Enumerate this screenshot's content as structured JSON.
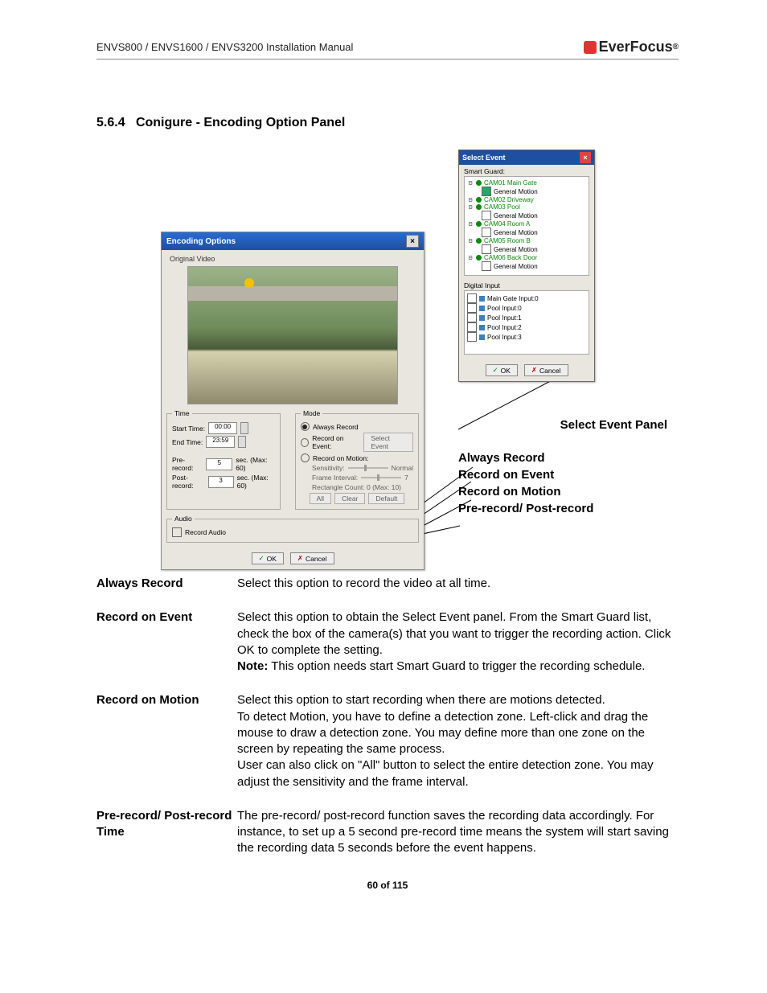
{
  "header": {
    "manual_title": "ENVS800 / ENVS1600 / ENVS3200 Installation Manual",
    "brand": "EverFocus"
  },
  "section": {
    "number": "5.6.4",
    "title": "Conigure -  Encoding Option Panel"
  },
  "encoding_panel": {
    "title": "Encoding Options",
    "original_video": "Original Video",
    "time": {
      "legend": "Time",
      "start_label": "Start Time:",
      "start_value": "00:00",
      "end_label": "End Time:",
      "end_value": "23:59",
      "pre_label": "Pre-record:",
      "pre_value": "5",
      "pre_unit": "sec. (Max: 60)",
      "post_label": "Post-record:",
      "post_value": "3",
      "post_unit": "sec. (Max: 60)"
    },
    "mode": {
      "legend": "Mode",
      "always": "Always Record",
      "on_event": "Record on Event:",
      "select_event_btn": "Select Event",
      "on_motion": "Record on Motion:",
      "sensitivity": "Sensitivity:",
      "sens_val": "Normal",
      "frame_interval": "Frame Interval:",
      "fi_val": "7",
      "rect_count": "Rectangle Count: 0  (Max: 10)",
      "all": "All",
      "clear": "Clear",
      "default": "Default"
    },
    "audio": {
      "legend": "Audio",
      "record_audio": "Record Audio"
    },
    "ok": "OK",
    "cancel": "Cancel"
  },
  "select_event": {
    "title": "Select Event",
    "smart_guard": "Smart Guard:",
    "cams": [
      {
        "name": "CAM01 Main Gate",
        "gm_checked": true
      },
      {
        "name": "CAM02 Driveway",
        "gm_checked": false,
        "no_gm": true
      },
      {
        "name": "CAM03 Pool",
        "gm_checked": false
      },
      {
        "name": "CAM04 Room A",
        "gm_checked": false
      },
      {
        "name": "CAM05 Room B",
        "gm_checked": false
      },
      {
        "name": "CAM06 Back Door",
        "gm_checked": false
      }
    ],
    "gm_label": "General Motion",
    "digital_input": "Digital Input",
    "di_items": [
      "Main Gate Input:0",
      "Pool Input:0",
      "Pool Input:1",
      "Pool Input:2",
      "Pool Input:3"
    ],
    "ok": "OK",
    "cancel": "Cancel"
  },
  "callouts": {
    "select_event_panel": "Select Event Panel",
    "always_record": "Always Record",
    "record_on_event": "Record on Event",
    "record_on_motion": "Record on Motion",
    "pre_post": "Pre-record/ Post-record"
  },
  "descriptions": [
    {
      "term": "Always Record",
      "body": "Select this option to record the video at all time."
    },
    {
      "term": "Record on Event",
      "body": "Select this option to obtain the Select Event panel. From the Smart Guard list, check the box of the camera(s) that you want to trigger the recording action. Click OK to complete the setting.",
      "note_prefix": "Note:",
      "note": " This option needs start Smart Guard to trigger the recording schedule."
    },
    {
      "term": "Record on Motion",
      "body": "Select this option to start recording when there are motions detected.",
      "body2": "To detect Motion, you have to define a detection zone. Left-click and drag the mouse to draw a detection zone. You may define more than one zone on the screen by repeating the same process.",
      "body3": "User can also click on \"All\" button to select the entire detection zone. You may adjust the sensitivity and the frame interval."
    },
    {
      "term": "Pre-record/ Post-record Time",
      "body": " The pre-record/ post-record function saves the recording data accordingly. For instance, to set up a 5 second pre-record time means the system will start saving the recording data 5 seconds before the event happens."
    }
  ],
  "footer": {
    "page": "60 of 115"
  }
}
